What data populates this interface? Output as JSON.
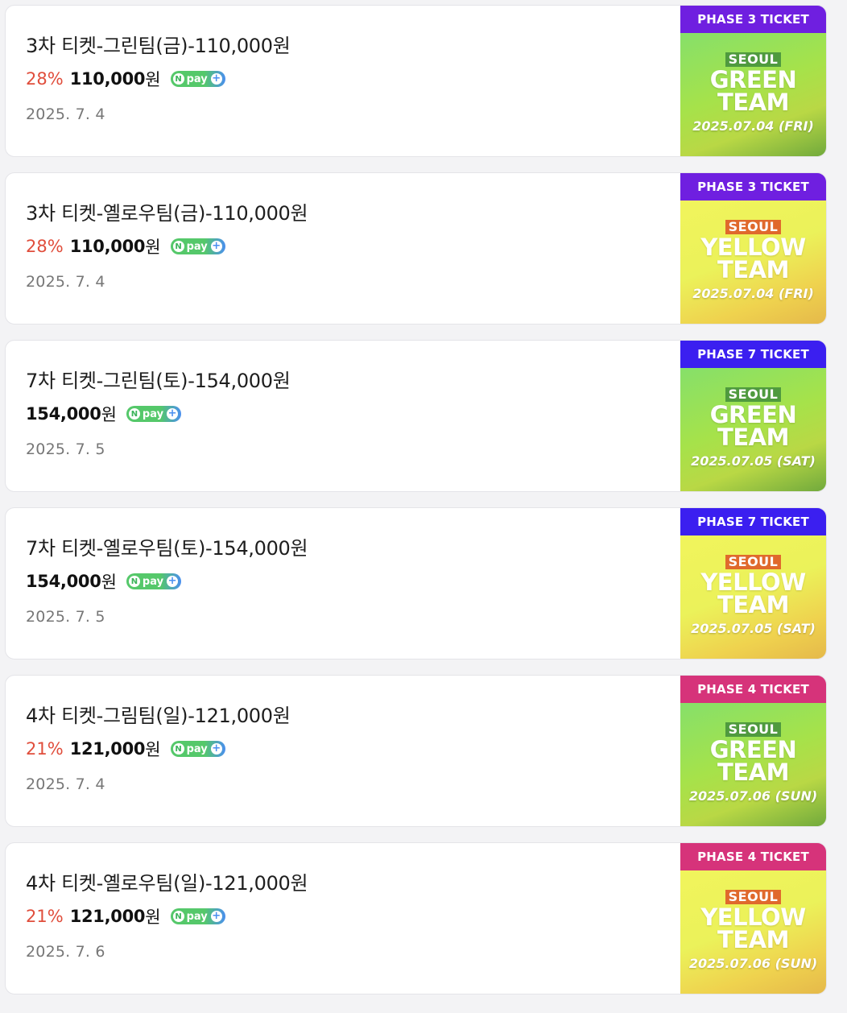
{
  "colors": {
    "discount": "#e04e3c",
    "phase3_banner": "#6f1fe0",
    "phase7_banner": "#3b1ff0",
    "phase4_banner": "#d6337a",
    "green_team": "#9fdf4e",
    "yellow_team": "#eef05a"
  },
  "npay": {
    "n": "N",
    "pay": "pay",
    "plus": "+"
  },
  "products": [
    {
      "title": "3차 티켓-그린팀(금)-110,000원",
      "discount": "28%",
      "price": "110,000",
      "price_unit": "원",
      "date": "2025. 7. 4",
      "thumb": {
        "banner": "PHASE 3 TICKET",
        "city": "SEOUL",
        "team_line1": "GREEN",
        "team_line2": "TEAM",
        "event_date": "2025.07.04 (FRI)",
        "theme": "green",
        "banner_color": "#6f1fe0"
      }
    },
    {
      "title": "3차 티켓-옐로우팀(금)-110,000원",
      "discount": "28%",
      "price": "110,000",
      "price_unit": "원",
      "date": "2025. 7. 4",
      "thumb": {
        "banner": "PHASE 3 TICKET",
        "city": "SEOUL",
        "team_line1": "YELLOW",
        "team_line2": "TEAM",
        "event_date": "2025.07.04 (FRI)",
        "theme": "yellow",
        "banner_color": "#6f1fe0"
      }
    },
    {
      "title": "7차 티켓-그린팀(토)-154,000원",
      "discount": "",
      "price": "154,000",
      "price_unit": "원",
      "date": "2025. 7. 5",
      "thumb": {
        "banner": "PHASE 7 TICKET",
        "city": "SEOUL",
        "team_line1": "GREEN",
        "team_line2": "TEAM",
        "event_date": "2025.07.05 (SAT)",
        "theme": "green",
        "banner_color": "#3b1ff0"
      }
    },
    {
      "title": "7차 티켓-옐로우팀(토)-154,000원",
      "discount": "",
      "price": "154,000",
      "price_unit": "원",
      "date": "2025. 7. 5",
      "thumb": {
        "banner": "PHASE 7 TICKET",
        "city": "SEOUL",
        "team_line1": "YELLOW",
        "team_line2": "TEAM",
        "event_date": "2025.07.05 (SAT)",
        "theme": "yellow",
        "banner_color": "#3b1ff0"
      }
    },
    {
      "title": "4차 티켓-그림팀(일)-121,000원",
      "discount": "21%",
      "price": "121,000",
      "price_unit": "원",
      "date": "2025. 7. 4",
      "thumb": {
        "banner": "PHASE 4 TICKET",
        "city": "SEOUL",
        "team_line1": "GREEN",
        "team_line2": "TEAM",
        "event_date": "2025.07.06 (SUN)",
        "theme": "green",
        "banner_color": "#d6337a"
      }
    },
    {
      "title": "4차 티켓-옐로우팀(일)-121,000원",
      "discount": "21%",
      "price": "121,000",
      "price_unit": "원",
      "date": "2025. 7. 6",
      "thumb": {
        "banner": "PHASE 4 TICKET",
        "city": "SEOUL",
        "team_line1": "YELLOW",
        "team_line2": "TEAM",
        "event_date": "2025.07.06 (SUN)",
        "theme": "yellow",
        "banner_color": "#d6337a"
      }
    }
  ]
}
